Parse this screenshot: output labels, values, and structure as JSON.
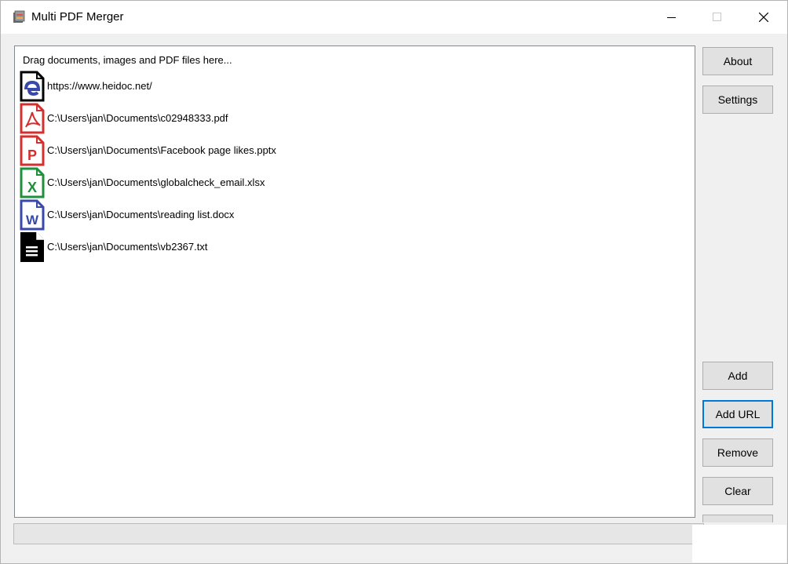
{
  "window": {
    "title": "Multi PDF Merger"
  },
  "list": {
    "hint": "Drag documents, images and PDF files here...",
    "items": [
      {
        "icon": "edge-web-icon",
        "path": "https://www.heidoc.net/"
      },
      {
        "icon": "pdf-file-icon",
        "path": "C:\\Users\\jan\\Documents\\c02948333.pdf"
      },
      {
        "icon": "powerpoint-file-icon",
        "path": "C:\\Users\\jan\\Documents\\Facebook page likes.pptx"
      },
      {
        "icon": "excel-file-icon",
        "path": "C:\\Users\\jan\\Documents\\globalcheck_email.xlsx"
      },
      {
        "icon": "word-file-icon",
        "path": "C:\\Users\\jan\\Documents\\reading list.docx"
      },
      {
        "icon": "text-file-icon",
        "path": "C:\\Users\\jan\\Documents\\vb2367.txt"
      }
    ]
  },
  "buttons": {
    "about": "About",
    "settings": "Settings",
    "add": "Add",
    "add_url": "Add URL",
    "remove": "Remove",
    "clear": "Clear"
  },
  "progress": {
    "value": 0
  },
  "colors": {
    "pdf": "#d32f2f",
    "powerpoint": "#d32f2f",
    "excel": "#1e8f3a",
    "word": "#3949ab",
    "edge": "#3949ab",
    "focus": "#0078d7"
  }
}
